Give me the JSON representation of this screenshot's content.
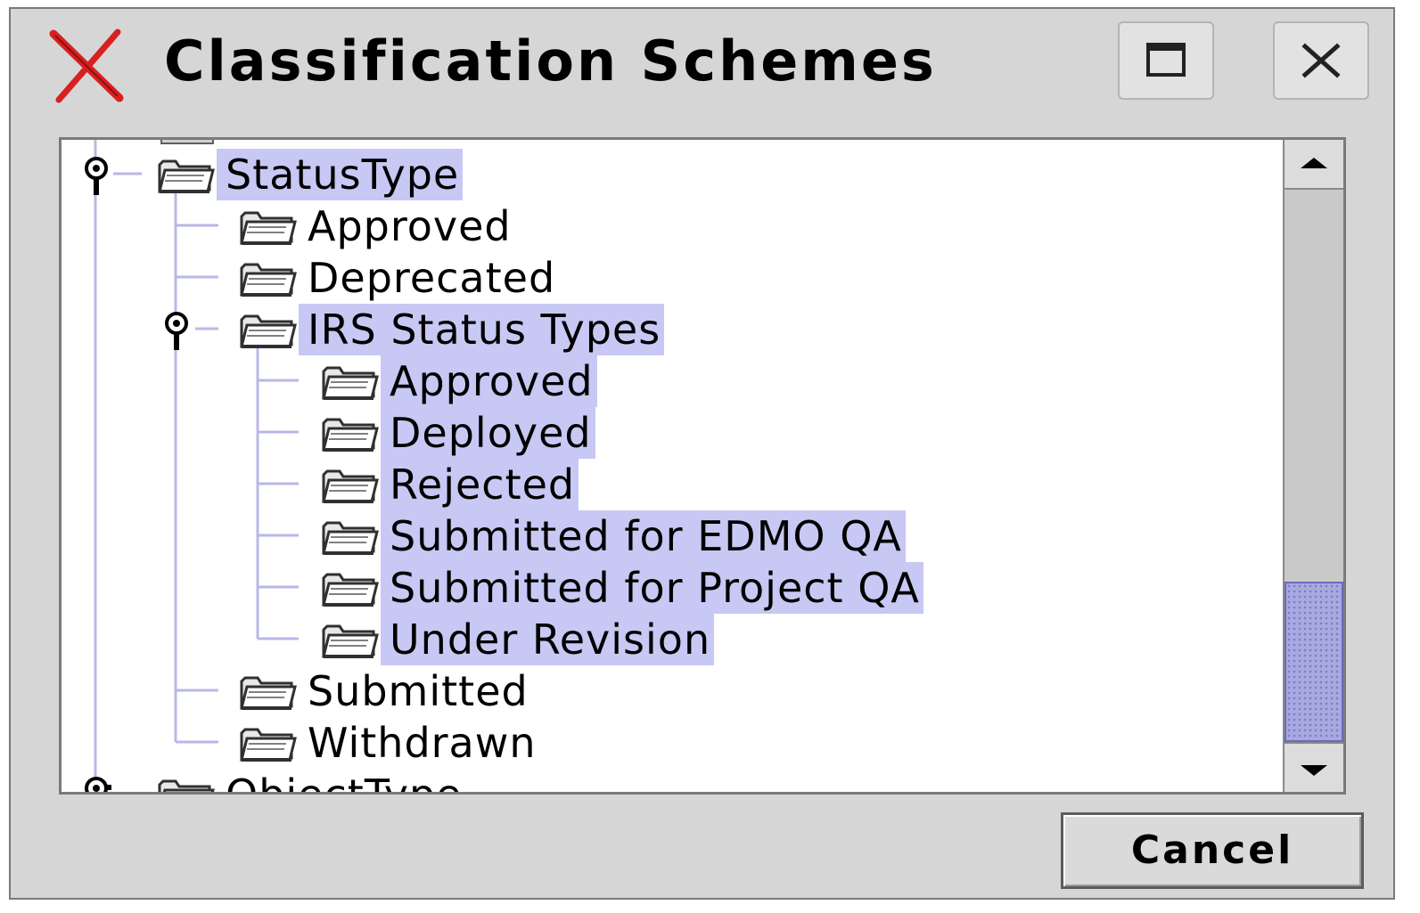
{
  "window": {
    "title": "Classification Schemes",
    "icon": "x-mark-icon",
    "accent_color": "#d82020"
  },
  "titlebar_buttons": {
    "maximize_icon": "maximize-icon",
    "close_icon": "close-icon"
  },
  "tree": {
    "selection_color": "#c8c8f4",
    "nodes": [
      {
        "label": "StatusType",
        "level": 0,
        "expanded": true,
        "selected": true
      },
      {
        "label": "Approved",
        "level": 1,
        "selected": false
      },
      {
        "label": "Deprecated",
        "level": 1,
        "selected": false
      },
      {
        "label": "IRS Status Types",
        "level": 1,
        "expanded": true,
        "selected": true
      },
      {
        "label": "Approved",
        "level": 2,
        "selected": true
      },
      {
        "label": "Deployed",
        "level": 2,
        "selected": true
      },
      {
        "label": "Rejected",
        "level": 2,
        "selected": true
      },
      {
        "label": "Submitted for EDMO QA",
        "level": 2,
        "selected": true
      },
      {
        "label": "Submitted for Project QA",
        "level": 2,
        "selected": true
      },
      {
        "label": "Under Revision",
        "level": 2,
        "selected": true
      },
      {
        "label": "Submitted",
        "level": 1,
        "selected": false
      },
      {
        "label": "Withdrawn",
        "level": 1,
        "selected": false
      },
      {
        "label": "ObjectType",
        "level": 0,
        "selected": false
      }
    ]
  },
  "scrollbar": {
    "position_fraction": 0.72
  },
  "buttons": {
    "cancel": "Cancel"
  }
}
